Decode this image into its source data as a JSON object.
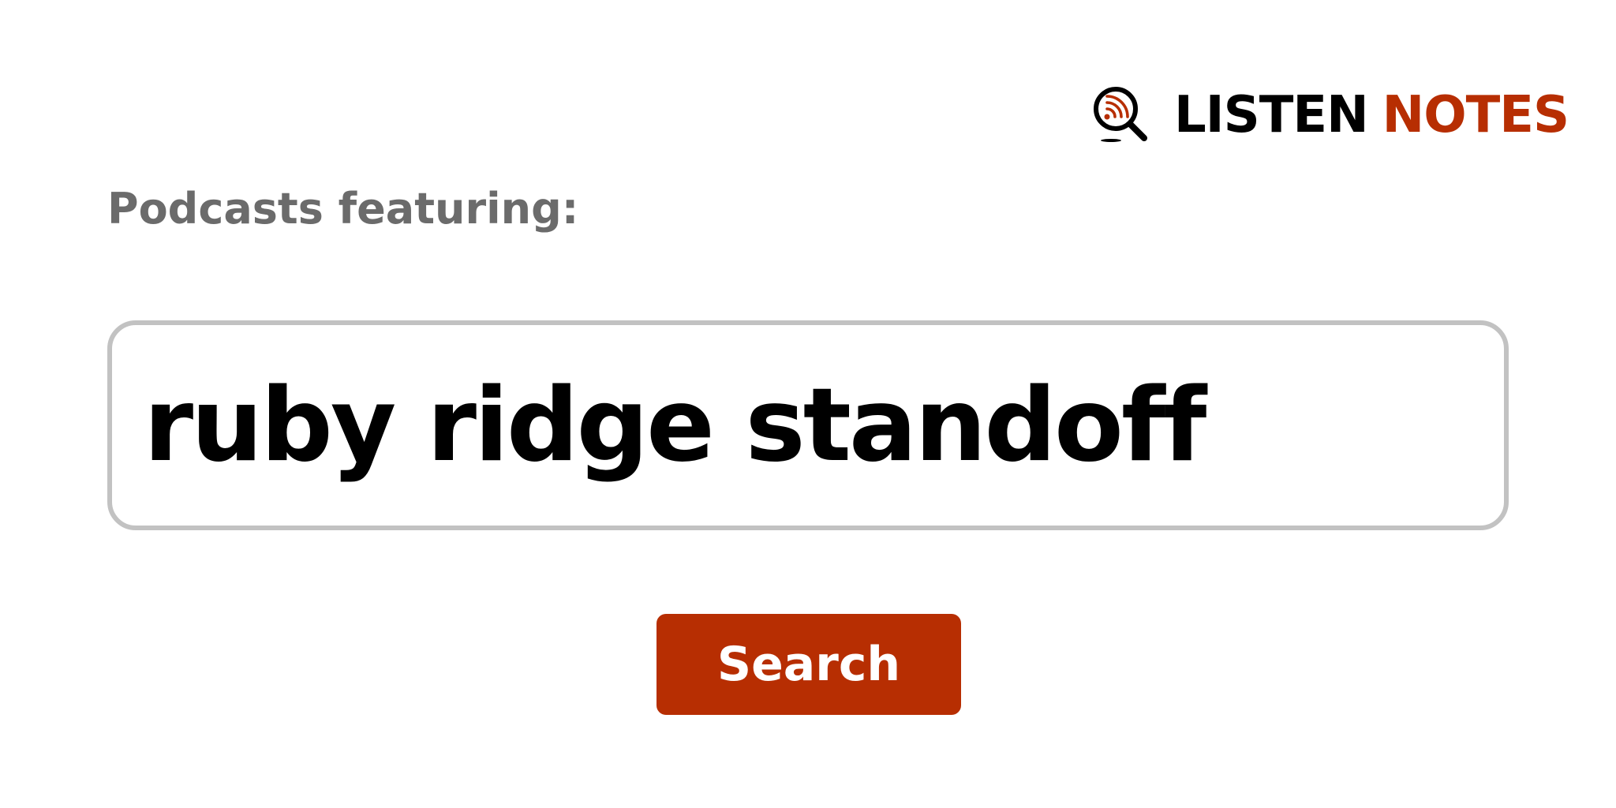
{
  "logo": {
    "word1": "LISTEN",
    "word2": "NOTES",
    "icon": "podcast-search-magnifier-icon",
    "colors": {
      "dark": "#000000",
      "accent": "#b72e02"
    }
  },
  "label": "Podcasts featuring:",
  "search": {
    "value": "ruby ridge standoff",
    "border_color": "#c2c2c2"
  },
  "button": {
    "label": "Search",
    "color": "#b72e02"
  }
}
